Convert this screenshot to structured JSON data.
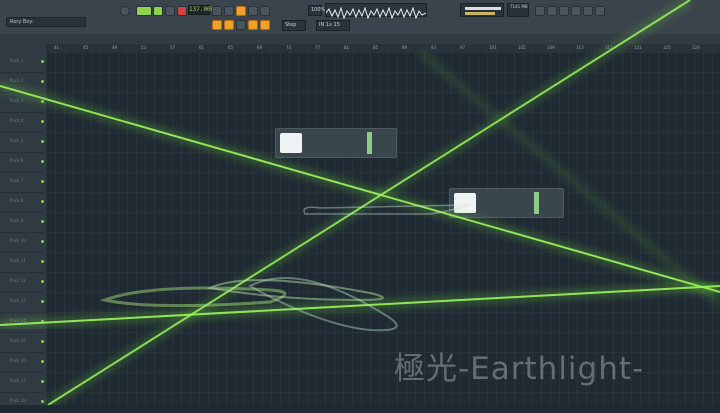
{
  "window": {
    "hint": "Rory Boy:"
  },
  "transport": {
    "tempo": "137.000",
    "snap": "Step",
    "channel": "IN 1x 15"
  },
  "status": {
    "cpu": "100%",
    "time_display": "7141 MB",
    "meter_value": "15"
  },
  "ruler": {
    "ticks": [
      "41",
      "45",
      "49",
      "53",
      "57",
      "61",
      "65",
      "69",
      "73",
      "77",
      "81",
      "85",
      "89",
      "93",
      "97",
      "101",
      "105",
      "109",
      "113",
      "117",
      "121",
      "125",
      "129"
    ]
  },
  "tracks": [
    {
      "label": "Track 1"
    },
    {
      "label": "Track 2"
    },
    {
      "label": "Track 3"
    },
    {
      "label": "Track 4"
    },
    {
      "label": "Track 5"
    },
    {
      "label": "Track 6"
    },
    {
      "label": "Track 7"
    },
    {
      "label": "Track 8"
    },
    {
      "label": "Track 9"
    },
    {
      "label": "Track 10"
    },
    {
      "label": "Track 11"
    },
    {
      "label": "Track 12"
    },
    {
      "label": "Track 13"
    },
    {
      "label": "Track 14"
    },
    {
      "label": "Track 15"
    },
    {
      "label": "Track 16"
    },
    {
      "label": "Track 17"
    },
    {
      "label": "Track 18"
    }
  ],
  "watermark": "極光-Earthlight-",
  "colors": {
    "accent": "#8ed14b",
    "laser": "#7ff23a",
    "background": "#1f2a33"
  }
}
